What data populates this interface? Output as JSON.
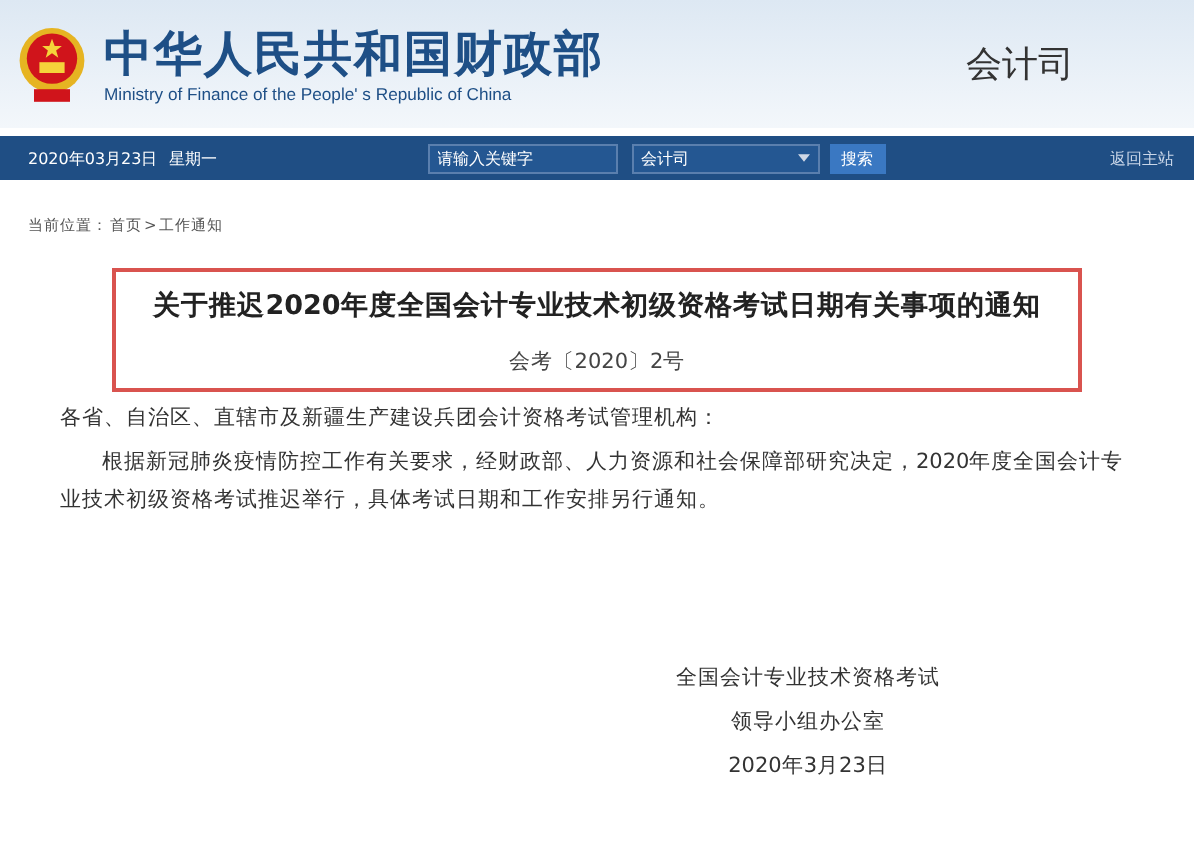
{
  "header": {
    "title": "中华人民共和国财政部",
    "subtitle": "Ministry of Finance of the People' s Republic of China",
    "department": "会计司"
  },
  "nav": {
    "date": "2020年03月23日",
    "weekday": "星期一",
    "search": {
      "placeholder": "请输入关键字"
    },
    "scope": {
      "value": "会计司"
    },
    "search_button": "搜索",
    "home_link": "返回主站"
  },
  "breadcrumb": {
    "label": "当前位置：",
    "items": [
      "首页",
      "工作通知"
    ],
    "separator": ">"
  },
  "notice": {
    "title": "关于推迟2020年度全国会计专业技术初级资格考试日期有关事项的通知",
    "number": "会考〔2020〕2号",
    "salutation": "各省、自治区、直辖市及新疆生产建设兵团会计资格考试管理机构：",
    "paragraphs": [
      "根据新冠肺炎疫情防控工作有关要求，经财政部、人力资源和社会保障部研究决定，2020年度全国会计专业技术初级资格考试推迟举行，具体考试日期和工作安排另行通知。"
    ],
    "signature": [
      "全国会计专业技术资格考试",
      "领导小组办公室",
      "2020年3月23日"
    ]
  }
}
